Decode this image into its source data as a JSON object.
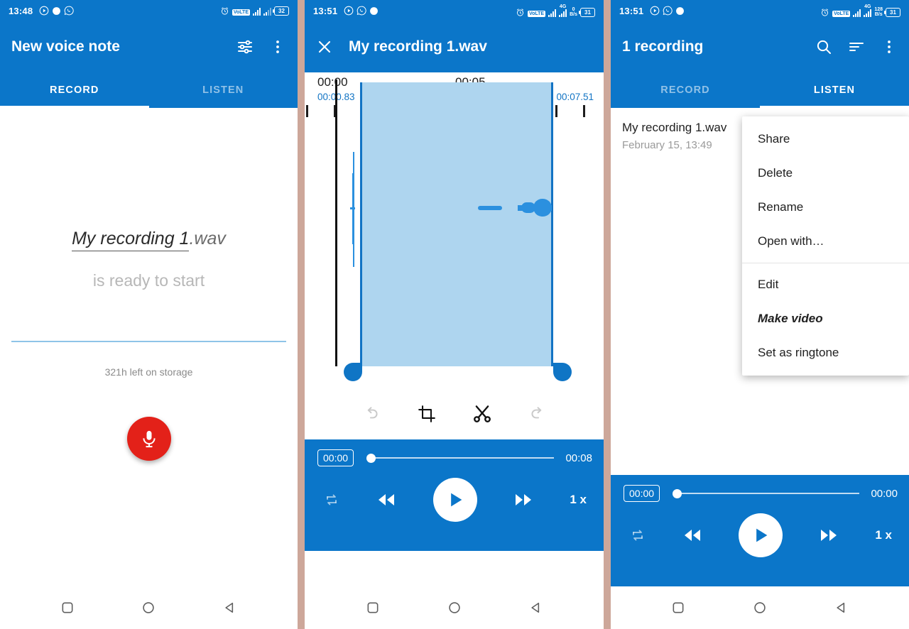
{
  "panel1": {
    "statusbar": {
      "time": "13:48",
      "battery": "32",
      "volte": "VoLTE",
      "icons": [
        "play-circle-icon",
        "record-dot-icon",
        "whatsapp-icon",
        "alarm-icon",
        "signal-bars-icon",
        "battery-icon"
      ]
    },
    "appbar": {
      "title": "New voice note",
      "actions": [
        "tune-icon",
        "overflow-menu-icon"
      ]
    },
    "tabs": [
      {
        "label": "RECORD",
        "active": true
      },
      {
        "label": "LISTEN",
        "active": false
      }
    ],
    "filename_base": "My recording 1",
    "filename_ext": ".wav",
    "ready_text": "is ready to start",
    "storage_text": "321h left on storage",
    "record_button": "record-mic-button"
  },
  "panel2": {
    "statusbar": {
      "time": "13:51",
      "battery": "31",
      "volte": "VoLTE",
      "network": "4G",
      "datarate_value": "0",
      "datarate_unit": "B/s"
    },
    "appbar": {
      "close_label": "close-icon",
      "title": "My recording 1.wav"
    },
    "ruler": {
      "label_start": "00:00",
      "label_mid": "00:05"
    },
    "selection": {
      "start": "00:00.83",
      "end": "00:07.51"
    },
    "tools": [
      {
        "name": "undo-icon",
        "enabled": false
      },
      {
        "name": "crop-icon",
        "enabled": true
      },
      {
        "name": "cut-scissors-icon",
        "enabled": true
      },
      {
        "name": "redo-icon",
        "enabled": false
      }
    ],
    "player": {
      "current_time": "00:00",
      "total_time": "00:08",
      "speed": "1 x",
      "controls": [
        "repeat-icon",
        "rewind-icon",
        "play-icon",
        "fast-forward-icon",
        "speed-label"
      ]
    }
  },
  "panel3": {
    "statusbar": {
      "time": "13:51",
      "battery": "31",
      "volte": "VoLTE",
      "network": "4G",
      "datarate_value": "128",
      "datarate_unit": "B/s"
    },
    "appbar": {
      "title": "1 recording",
      "actions": [
        "search-icon",
        "sort-icon",
        "overflow-menu-icon"
      ]
    },
    "tabs": [
      {
        "label": "RECORD",
        "active": false
      },
      {
        "label": "LISTEN",
        "active": true
      }
    ],
    "recording": {
      "name": "My recording 1.wav",
      "date": "February 15, 13:49"
    },
    "context_menu": [
      {
        "label": "Share",
        "emphasis": false
      },
      {
        "label": "Delete",
        "emphasis": false
      },
      {
        "label": "Rename",
        "emphasis": false
      },
      {
        "label": "Open with…",
        "emphasis": false
      },
      {
        "label": "Edit",
        "emphasis": false
      },
      {
        "label": "Make video",
        "emphasis": true
      },
      {
        "label": "Set as ringtone",
        "emphasis": false
      }
    ],
    "player": {
      "current_time": "00:00",
      "total_time": "00:00",
      "speed": "1 x"
    }
  },
  "colors": {
    "appbar_blue": "#0b76c9",
    "record_red": "#e32119",
    "selection_fill": "#aed5ef",
    "selection_edge": "#1273c4",
    "divider": "#cda79a"
  },
  "navbar": {
    "buttons": [
      "recents-square-icon",
      "home-circle-icon",
      "back-triangle-icon"
    ]
  }
}
